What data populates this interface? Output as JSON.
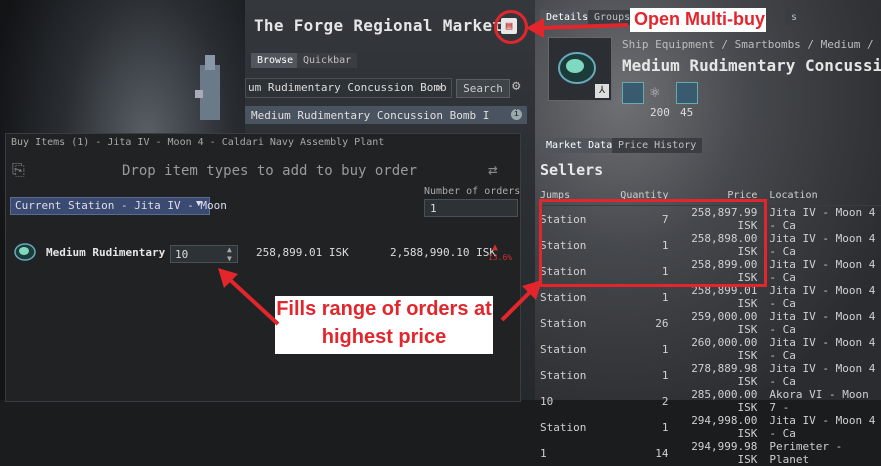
{
  "header": {
    "title": "The Forge Regional Market"
  },
  "browse": {
    "tabs": [
      "Browse",
      "Quickbar"
    ],
    "search_value": "um Rudimentary Concussion Bomb",
    "search_button": "Search",
    "result_item": "Medium Rudimentary Concussion Bomb I"
  },
  "info_panel": {
    "tabs": [
      "Details",
      "Groups",
      "s"
    ],
    "breadcrumb": "Ship Equipment / Smartbombs / Medium /",
    "item_name": "Medium Rudimentary Concussion",
    "stats": [
      "200",
      "45"
    ]
  },
  "market_tabs": [
    "Market Data",
    "Price History"
  ],
  "sellers": {
    "heading": "Sellers",
    "columns": [
      "Jumps",
      "Quantity",
      "Price",
      "Location"
    ],
    "rows": [
      {
        "jumps": "Station",
        "qty": "7",
        "price": "258,897.99 ISK",
        "loc": "Jita IV - Moon 4 - Ca"
      },
      {
        "jumps": "Station",
        "qty": "1",
        "price": "258,898.00 ISK",
        "loc": "Jita IV - Moon 4 - Ca"
      },
      {
        "jumps": "Station",
        "qty": "1",
        "price": "258,899.00 ISK",
        "loc": "Jita IV - Moon 4 - Ca"
      },
      {
        "jumps": "Station",
        "qty": "1",
        "price": "258,899.01 ISK",
        "loc": "Jita IV - Moon 4 - Ca"
      },
      {
        "jumps": "Station",
        "qty": "26",
        "price": "259,000.00 ISK",
        "loc": "Jita IV - Moon 4 - Ca"
      },
      {
        "jumps": "Station",
        "qty": "1",
        "price": "260,000.00 ISK",
        "loc": "Jita IV - Moon 4 - Ca"
      },
      {
        "jumps": "Station",
        "qty": "1",
        "price": "278,889.98 ISK",
        "loc": "Jita IV - Moon 4 - Ca"
      },
      {
        "jumps": "10",
        "qty": "2",
        "price": "285,000.00 ISK",
        "loc": "Akora VI - Moon 7 -"
      },
      {
        "jumps": "Station",
        "qty": "1",
        "price": "294,998.00 ISK",
        "loc": "Jita IV - Moon 4 - Ca"
      },
      {
        "jumps": "1",
        "qty": "14",
        "price": "294,999.98 ISK",
        "loc": "Perimeter - Planet"
      }
    ]
  },
  "buy_window": {
    "title": "Buy Items (1) - Jita IV - Moon 4 - Caldari Navy Assembly Plant",
    "drop_hint": "Drop item types to add to buy order",
    "orders_label": "Number of orders",
    "orders_value": "1",
    "location_select": "Current Station - Jita IV - Moon",
    "item": {
      "name": "Medium Rudimentary",
      "qty": "10",
      "unit_price": "258,899.01 ISK",
      "total": "2,588,990.10 ISK",
      "pct": "13.6%"
    }
  },
  "annotations": {
    "multibuy": "Open Multi-buy",
    "fills_line1": "Fills range of orders at",
    "fills_line2": "highest price"
  },
  "colors": {
    "annotation_red": "#e3262c",
    "panel_bg": "#202224"
  }
}
